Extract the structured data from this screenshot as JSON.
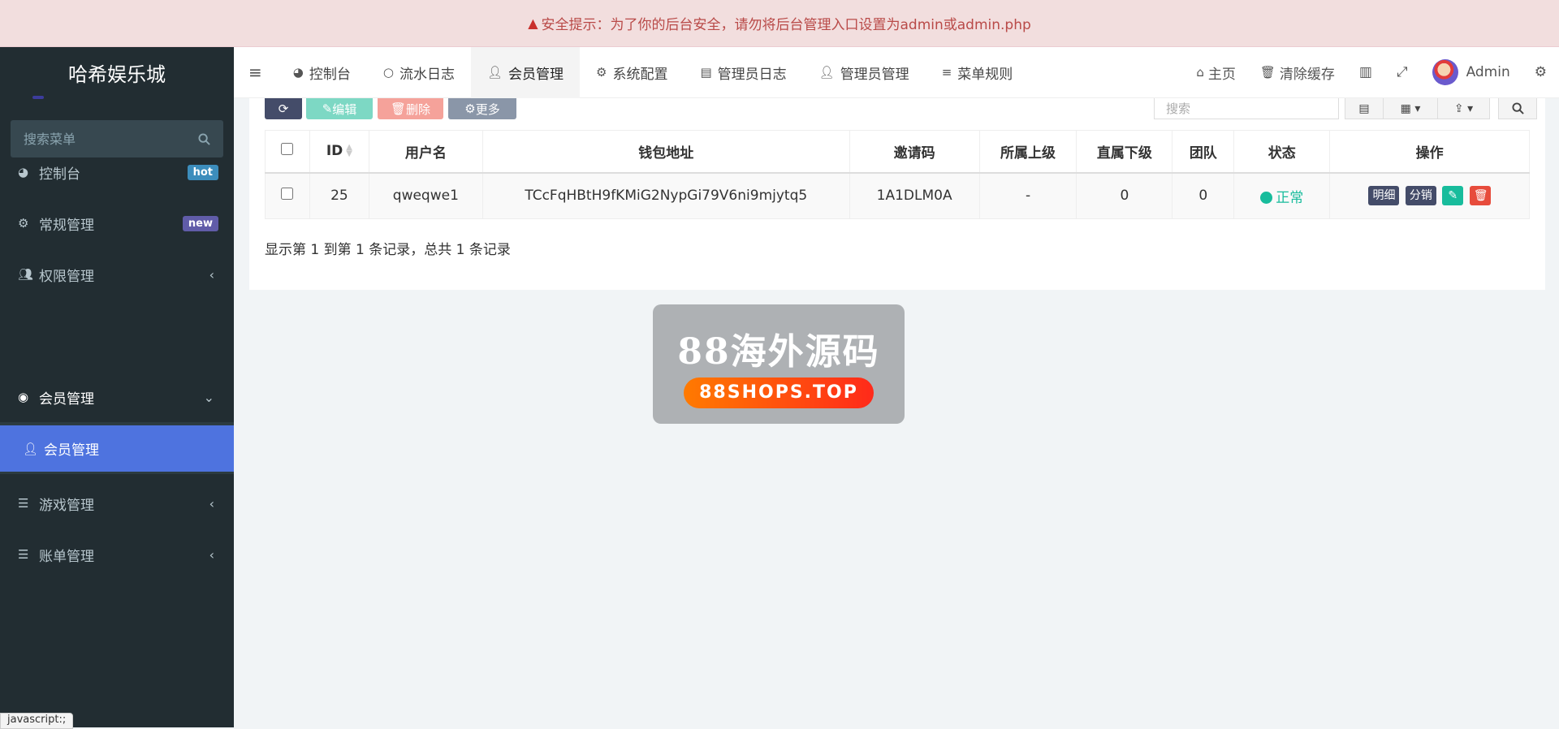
{
  "alert": {
    "text": "安全提示：为了你的后台安全，请勿将后台管理入口设置为admin或admin.php",
    "icon": "warning-triangle-icon"
  },
  "sidebar": {
    "brand": "哈希娱乐城",
    "search_placeholder": "搜索菜单",
    "items": [
      {
        "label": "控制台",
        "icon": "dashboard-icon",
        "badge": "hot",
        "badge_color": "#3c8dbc"
      },
      {
        "label": "常规管理",
        "icon": "cogs-icon",
        "badge": "new",
        "badge_color": "#605ca8"
      },
      {
        "label": "权限管理",
        "icon": "users-icon"
      },
      {
        "label": "会员管理",
        "icon": "user-circle-icon"
      },
      {
        "label": "会员管理",
        "icon": "user-icon"
      },
      {
        "label": "游戏管理",
        "icon": "list-icon"
      },
      {
        "label": "账单管理",
        "icon": "list-icon"
      }
    ]
  },
  "topnav": {
    "tabs": [
      {
        "label": "控制台",
        "icon": "dashboard-icon"
      },
      {
        "label": "流水日志",
        "icon": "circle-icon"
      },
      {
        "label": "会员管理",
        "icon": "user-icon"
      },
      {
        "label": "系统配置",
        "icon": "gear-icon"
      },
      {
        "label": "管理员日志",
        "icon": "list-alt-icon"
      },
      {
        "label": "管理员管理",
        "icon": "user-icon"
      },
      {
        "label": "菜单规则",
        "icon": "bars-icon"
      }
    ],
    "home": "主页",
    "clear_cache": "清除缓存",
    "user": "Admin"
  },
  "toolbar": {
    "edit": "编辑",
    "delete": "删除",
    "more": "更多",
    "search_placeholder": "搜索"
  },
  "table": {
    "headers": [
      "ID",
      "用户名",
      "钱包地址",
      "邀请码",
      "所属上级",
      "直属下级",
      "团队",
      "状态",
      "操作"
    ],
    "rows": [
      {
        "id": "25",
        "username": "qweqwe1",
        "wallet": "TCcFqHBtH9fKMiG2NypGi79V6ni9mjytq5",
        "invite": "1A1DLM0A",
        "parent": "-",
        "direct": "0",
        "team": "0",
        "status": "正常"
      }
    ],
    "op_detail": "明细",
    "op_share": "分销",
    "summary": "显示第 1 到第 1 条记录，总共 1 条记录"
  },
  "watermark": {
    "title": "88海外源码",
    "subtitle": "88SHOPS.TOP"
  },
  "status_tip": "javascript:;"
}
